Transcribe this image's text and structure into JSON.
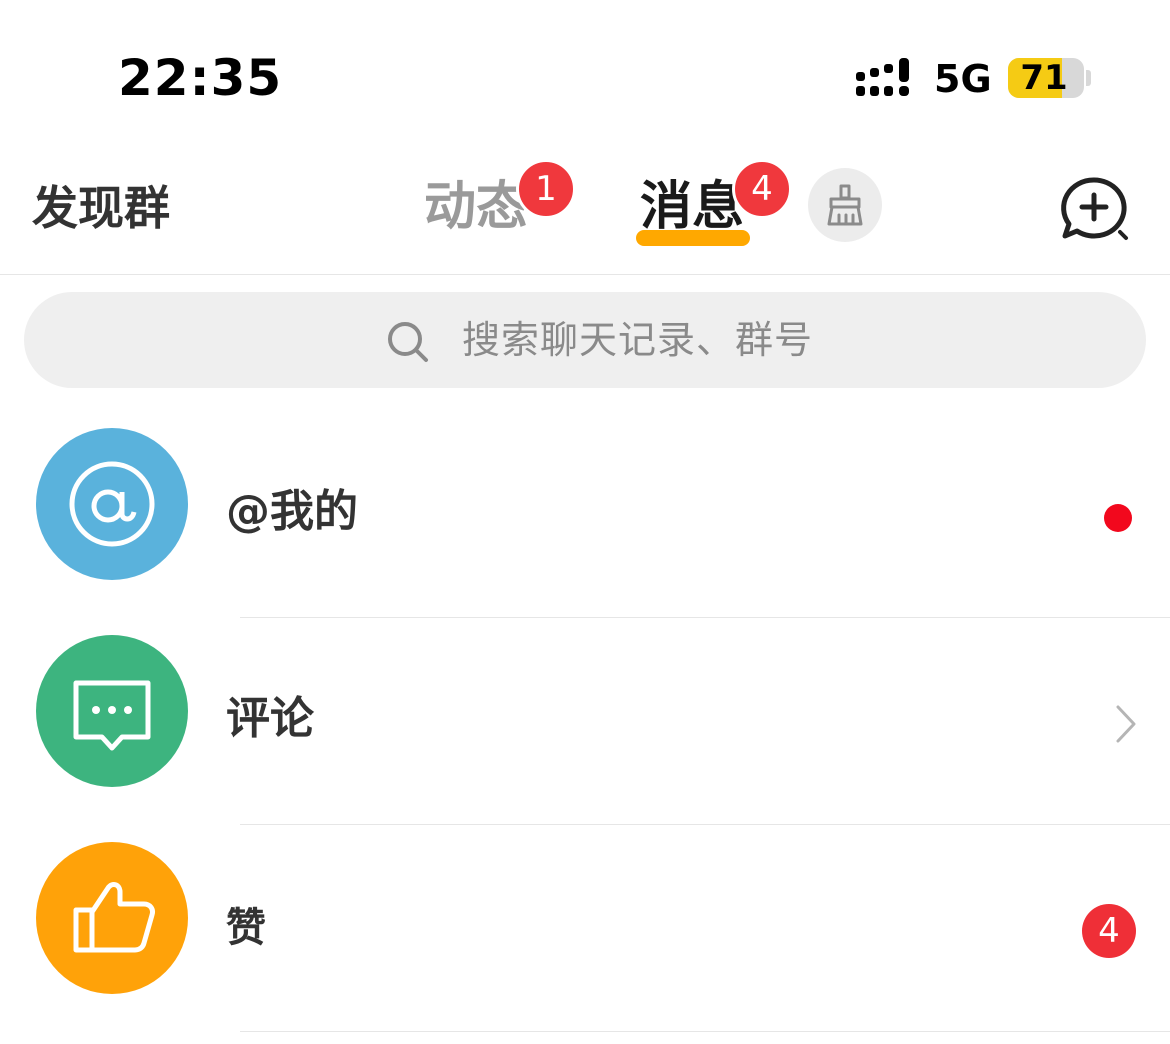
{
  "status_bar": {
    "time": "22:35",
    "network": "5G",
    "battery_percent": 71,
    "battery_label": "71",
    "battery_color": "#f5cb14"
  },
  "header": {
    "discover_label": "发现群",
    "tabs": [
      {
        "label": "动态",
        "badge": "1",
        "active": false
      },
      {
        "label": "消息",
        "badge": "4",
        "active": true
      }
    ],
    "active_underline_color": "#ffa800",
    "clean_icon": "broom-icon",
    "new_chat_icon": "chat-plus-icon"
  },
  "search": {
    "icon": "search-icon",
    "placeholder": "搜索聊天记录、群号"
  },
  "list": {
    "items": [
      {
        "label": "@我的",
        "icon": "at-icon",
        "icon_bg": "#5ab2dc",
        "indicator": "red-dot"
      },
      {
        "label": "评论",
        "icon": "comment-icon",
        "icon_bg": "#3db47f",
        "indicator": "chevron-right-icon"
      },
      {
        "label": "赞",
        "icon": "thumbs-up-icon",
        "icon_bg": "#ffa209",
        "badge": "4"
      }
    ]
  }
}
